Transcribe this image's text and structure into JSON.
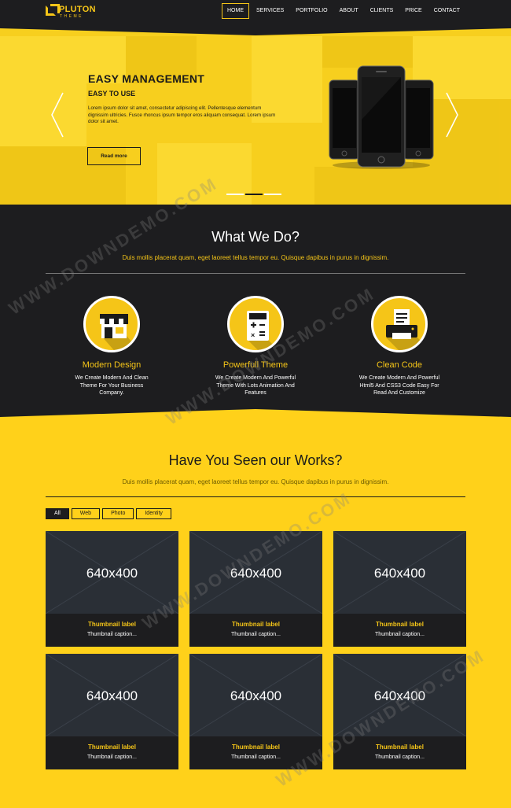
{
  "header": {
    "logo_title": "PLUTON",
    "logo_sub": "THEME",
    "nav": [
      "HOME",
      "SERVICES",
      "PORTFOLIO",
      "ABOUT",
      "CLIENTS",
      "PRICE",
      "CONTACT"
    ],
    "active_nav": "HOME"
  },
  "hero": {
    "title": "EASY MANAGEMENT",
    "subtitle": "EASY TO USE",
    "text": "Lorem ipsum dolor sit amet, consectetur adipiscing elit. Pellentesque elementum dignissim ultricies. Fusce rhoncus ipsum tempor eros aliquam consequat. Lorem ipsum dolor sit amet.",
    "button": "Read more",
    "prev_icon": "chevron-left-icon",
    "next_icon": "chevron-right-icon",
    "slides": 3,
    "active_slide": 2
  },
  "what_we_do": {
    "title": "What We Do?",
    "subtitle": "Duis mollis placerat quam, eget laoreet tellus tempor eu. Quisque dapibus in purus in dignissim.",
    "features": [
      {
        "icon": "storefront-icon",
        "title": "Modern Design",
        "text": "We Create Modern And Clean Theme For Your Business Company."
      },
      {
        "icon": "calculator-icon",
        "title": "Powerfull Theme",
        "text": "We Create Modern And Powerful Theme With Lots Animation And Features"
      },
      {
        "icon": "printer-icon",
        "title": "Clean Code",
        "text": "We Create Modern And Powerful Html5 And CSS3 Code Easy For Read And Customize"
      }
    ]
  },
  "works": {
    "title": "Have You Seen our Works?",
    "subtitle": "Duis mollis placerat quam, eget laoreet tellus tempor eu. Quisque dapibus in purus in dignissim.",
    "filters": [
      "All",
      "Web",
      "Photo",
      "Identity"
    ],
    "active_filter": "All",
    "items": [
      {
        "size": "640x400",
        "label": "Thumbnail label",
        "caption": "Thumbnail caption..."
      },
      {
        "size": "640x400",
        "label": "Thumbnail label",
        "caption": "Thumbnail caption..."
      },
      {
        "size": "640x400",
        "label": "Thumbnail label",
        "caption": "Thumbnail caption..."
      },
      {
        "size": "640x400",
        "label": "Thumbnail label",
        "caption": "Thumbnail caption..."
      },
      {
        "size": "640x400",
        "label": "Thumbnail label",
        "caption": "Thumbnail caption..."
      },
      {
        "size": "640x400",
        "label": "Thumbnail label",
        "caption": "Thumbnail caption..."
      }
    ]
  },
  "watermark": "WWW.DOWNDEMO.COM",
  "colors": {
    "accent": "#f5c518",
    "dark": "#1d1d1f",
    "hero": "#f7cf1e",
    "page": "#ffd11a",
    "thumb": "#2a2f36"
  }
}
